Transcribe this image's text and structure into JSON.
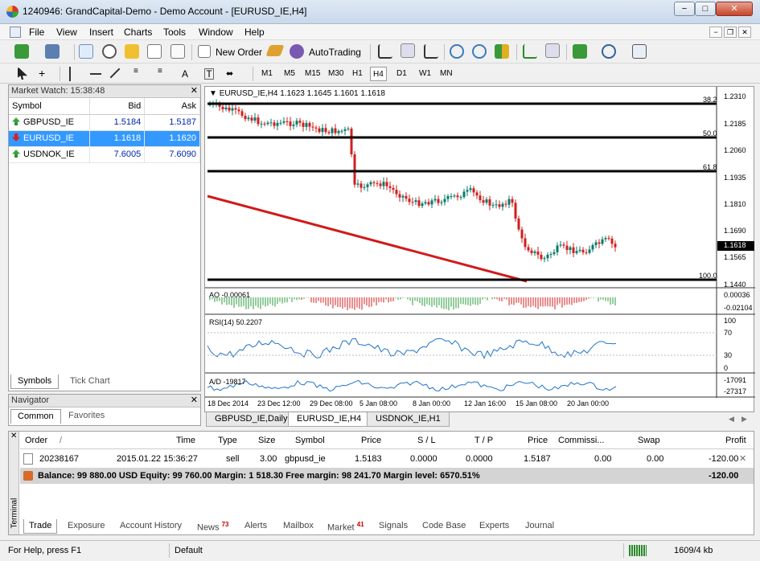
{
  "window": {
    "title": "1240946: GrandCapital-Demo - Demo Account - [EURUSD_IE,H4]",
    "min": "−",
    "max": "□",
    "close": "✕"
  },
  "menu": [
    "File",
    "View",
    "Insert",
    "Charts",
    "Tools",
    "Window",
    "Help"
  ],
  "mdi": {
    "min": "−",
    "restore": "❐",
    "close": "✕"
  },
  "toolbar": {
    "new_order": "New Order",
    "autotrading": "AutoTrading"
  },
  "timeframes": [
    "M1",
    "M5",
    "M15",
    "M30",
    "H1",
    "H4",
    "D1",
    "W1",
    "MN"
  ],
  "drawing_labels": {
    "text": "A",
    "label": "T"
  },
  "market_watch": {
    "title": "Market Watch: 15:38:48",
    "columns": [
      "Symbol",
      "Bid",
      "Ask"
    ],
    "rows": [
      {
        "symbol": "GBPUSD_IE",
        "bid": "1.5184",
        "ask": "1.5187",
        "dir": "up"
      },
      {
        "symbol": "EURUSD_IE",
        "bid": "1.1618",
        "ask": "1.1620",
        "dir": "down"
      },
      {
        "symbol": "USDNOK_IE",
        "bid": "7.6005",
        "ask": "7.6090",
        "dir": "up"
      }
    ],
    "tabs": [
      "Symbols",
      "Tick Chart"
    ]
  },
  "navigator": {
    "title": "Navigator",
    "tabs": [
      "Common",
      "Favorites"
    ]
  },
  "chart": {
    "header": "EURUSD_IE,H4  1.1623 1.1645 1.1601 1.1618",
    "price_ticks": [
      "1.2310",
      "1.2185",
      "1.2060",
      "1.1935",
      "1.1810",
      "1.1690",
      "1.1565",
      "1.1440"
    ],
    "current_price": "1.1618",
    "fib_levels": [
      "38.2",
      "50.0",
      "61.8",
      "100.0"
    ],
    "time_ticks": [
      "18 Dec 2014",
      "23 Dec 12:00",
      "29 Dec 08:00",
      "5 Jan 08:00",
      "8 Jan 00:00",
      "12 Jan 16:00",
      "15 Jan 08:00",
      "20 Jan 00:00"
    ],
    "ao": {
      "label": "AO -0.00061",
      "ticks": [
        "0.00036",
        "-0.02104"
      ]
    },
    "rsi": {
      "label": "RSI(14) 50.2207",
      "ticks": [
        "100",
        "70",
        "30",
        "0"
      ]
    },
    "ad": {
      "label": "A/D -19817",
      "ticks": [
        "-17091",
        "-27317"
      ]
    },
    "tabs": [
      "GBPUSD_IE,Daily",
      "EURUSD_IE,H4",
      "USDNOK_IE,H1"
    ],
    "colors": {
      "up": "#0a7a6a",
      "down": "#d21e1e",
      "trend": "#d01a1a",
      "rsi": "#1e73c8"
    }
  },
  "terminal": {
    "side_label": "Terminal",
    "columns": [
      "Order",
      "/",
      "Time",
      "Type",
      "Size",
      "Symbol",
      "Price",
      "S / L",
      "T / P",
      "Price",
      "Commissi...",
      "Swap",
      "Profit"
    ],
    "order": {
      "id": "20238167",
      "time": "2015.01.22 15:36:27",
      "type": "sell",
      "size": "3.00",
      "symbol": "gbpusd_ie",
      "price": "1.5183",
      "sl": "0.0000",
      "tp": "0.0000",
      "cur_price": "1.5187",
      "commission": "0.00",
      "swap": "0.00",
      "profit": "-120.00"
    },
    "balance_line": "Balance: 99 880.00 USD  Equity: 99 760.00  Margin: 1 518.30  Free margin: 98 241.70  Margin level: 6570.51%",
    "balance_profit": "-120.00",
    "tabs": [
      {
        "label": "Trade"
      },
      {
        "label": "Exposure"
      },
      {
        "label": "Account History"
      },
      {
        "label": "News",
        "badge": "73"
      },
      {
        "label": "Alerts"
      },
      {
        "label": "Mailbox"
      },
      {
        "label": "Market",
        "badge": "41"
      },
      {
        "label": "Signals"
      },
      {
        "label": "Code Base"
      },
      {
        "label": "Experts"
      },
      {
        "label": "Journal"
      }
    ]
  },
  "status": {
    "help": "For Help, press F1",
    "profile": "Default",
    "traffic": "1609/4 kb"
  }
}
